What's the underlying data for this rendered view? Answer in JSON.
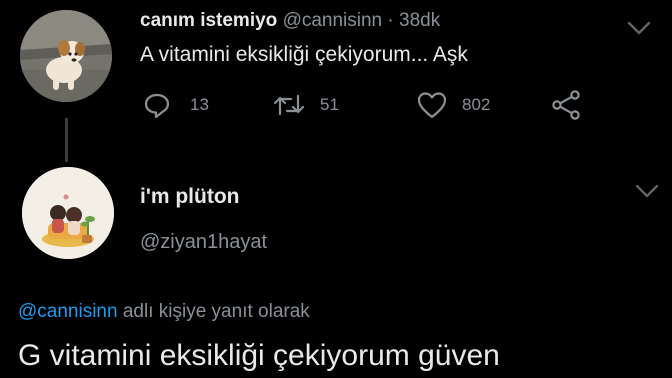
{
  "tweet": {
    "author_name": "canım istemiyo",
    "handle": "@cannisinn",
    "separator": "·",
    "time": "38dk",
    "text": "A vitamini eksikliği çekiyorum... Aşk",
    "replies": "13",
    "retweets": "51",
    "likes": "802",
    "avatar_icon": "puppy-photo"
  },
  "reply": {
    "author_name": "i'm plüton",
    "handle": "@ziyan1hayat",
    "replying_mention": "@cannisinn",
    "replying_suffix": "adlı kişiye yanıt olarak",
    "text": "G vitamini eksikliği çekiyorum güven",
    "avatar_icon": "illustrated-couple-avatar"
  },
  "colors": {
    "background": "#000000",
    "text": "#e7e9ea",
    "muted": "#8b9096",
    "link": "#1d9bf0",
    "thread_line": "#3a3d40"
  }
}
